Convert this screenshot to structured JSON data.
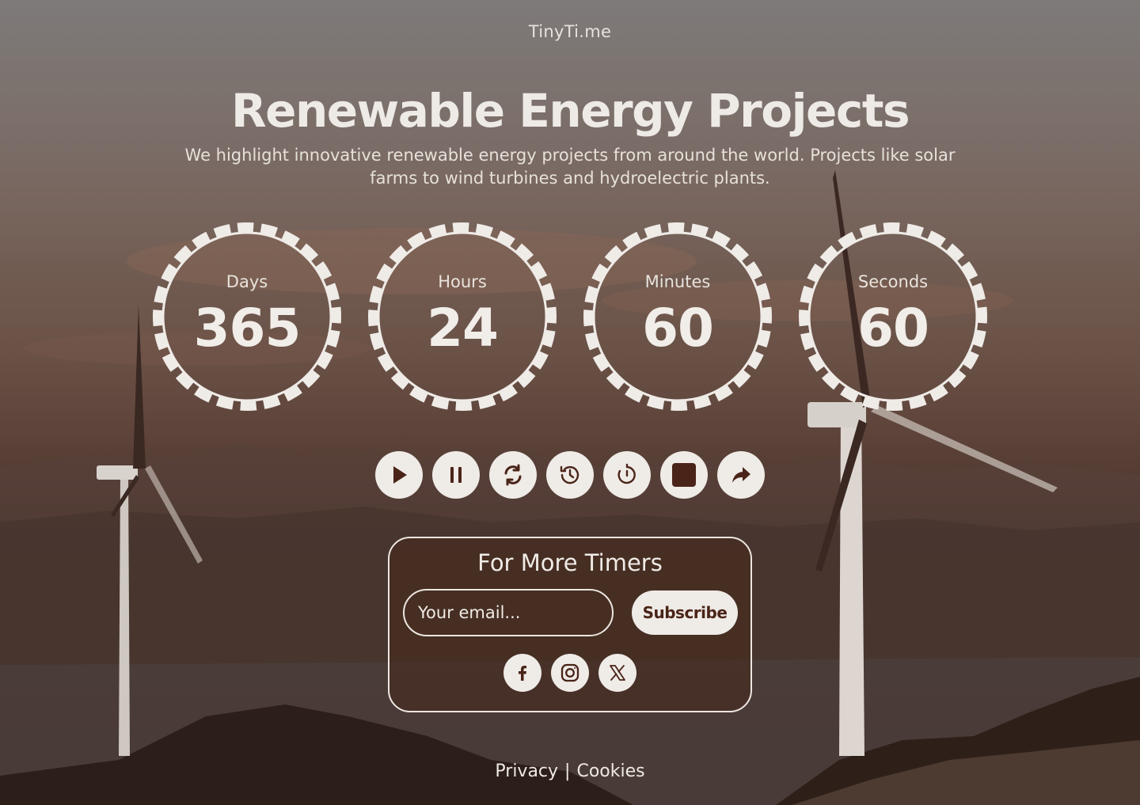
{
  "brand": "TinyTi.me",
  "title": "Renewable Energy Projects",
  "subtitle": "We highlight innovative renewable energy projects from around the world. Projects like solar farms to wind turbines and hydroelectric plants.",
  "dials": [
    {
      "label": "Days",
      "value": "365"
    },
    {
      "label": "Hours",
      "value": "24"
    },
    {
      "label": "Minutes",
      "value": "60"
    },
    {
      "label": "Seconds",
      "value": "60"
    }
  ],
  "controls": [
    {
      "name": "play-button",
      "icon": "play-icon"
    },
    {
      "name": "pause-button",
      "icon": "pause-icon"
    },
    {
      "name": "restart-button",
      "icon": "refresh-icon"
    },
    {
      "name": "history-button",
      "icon": "history-icon"
    },
    {
      "name": "timer-button",
      "icon": "timer-icon"
    },
    {
      "name": "stop-button",
      "icon": "stop-icon"
    },
    {
      "name": "share-button",
      "icon": "share-icon"
    }
  ],
  "signup": {
    "title": "For More Timers",
    "email_placeholder": "Your email...",
    "subscribe_label": "Subscribe",
    "social": [
      "facebook-icon",
      "instagram-icon",
      "x-icon"
    ]
  },
  "footer": {
    "privacy": "Privacy",
    "separator": "|",
    "cookies": "Cookies"
  },
  "colors": {
    "button_bg": "#efebe7",
    "icon_dark": "#4a2418",
    "text_light": "#efe9e3"
  }
}
